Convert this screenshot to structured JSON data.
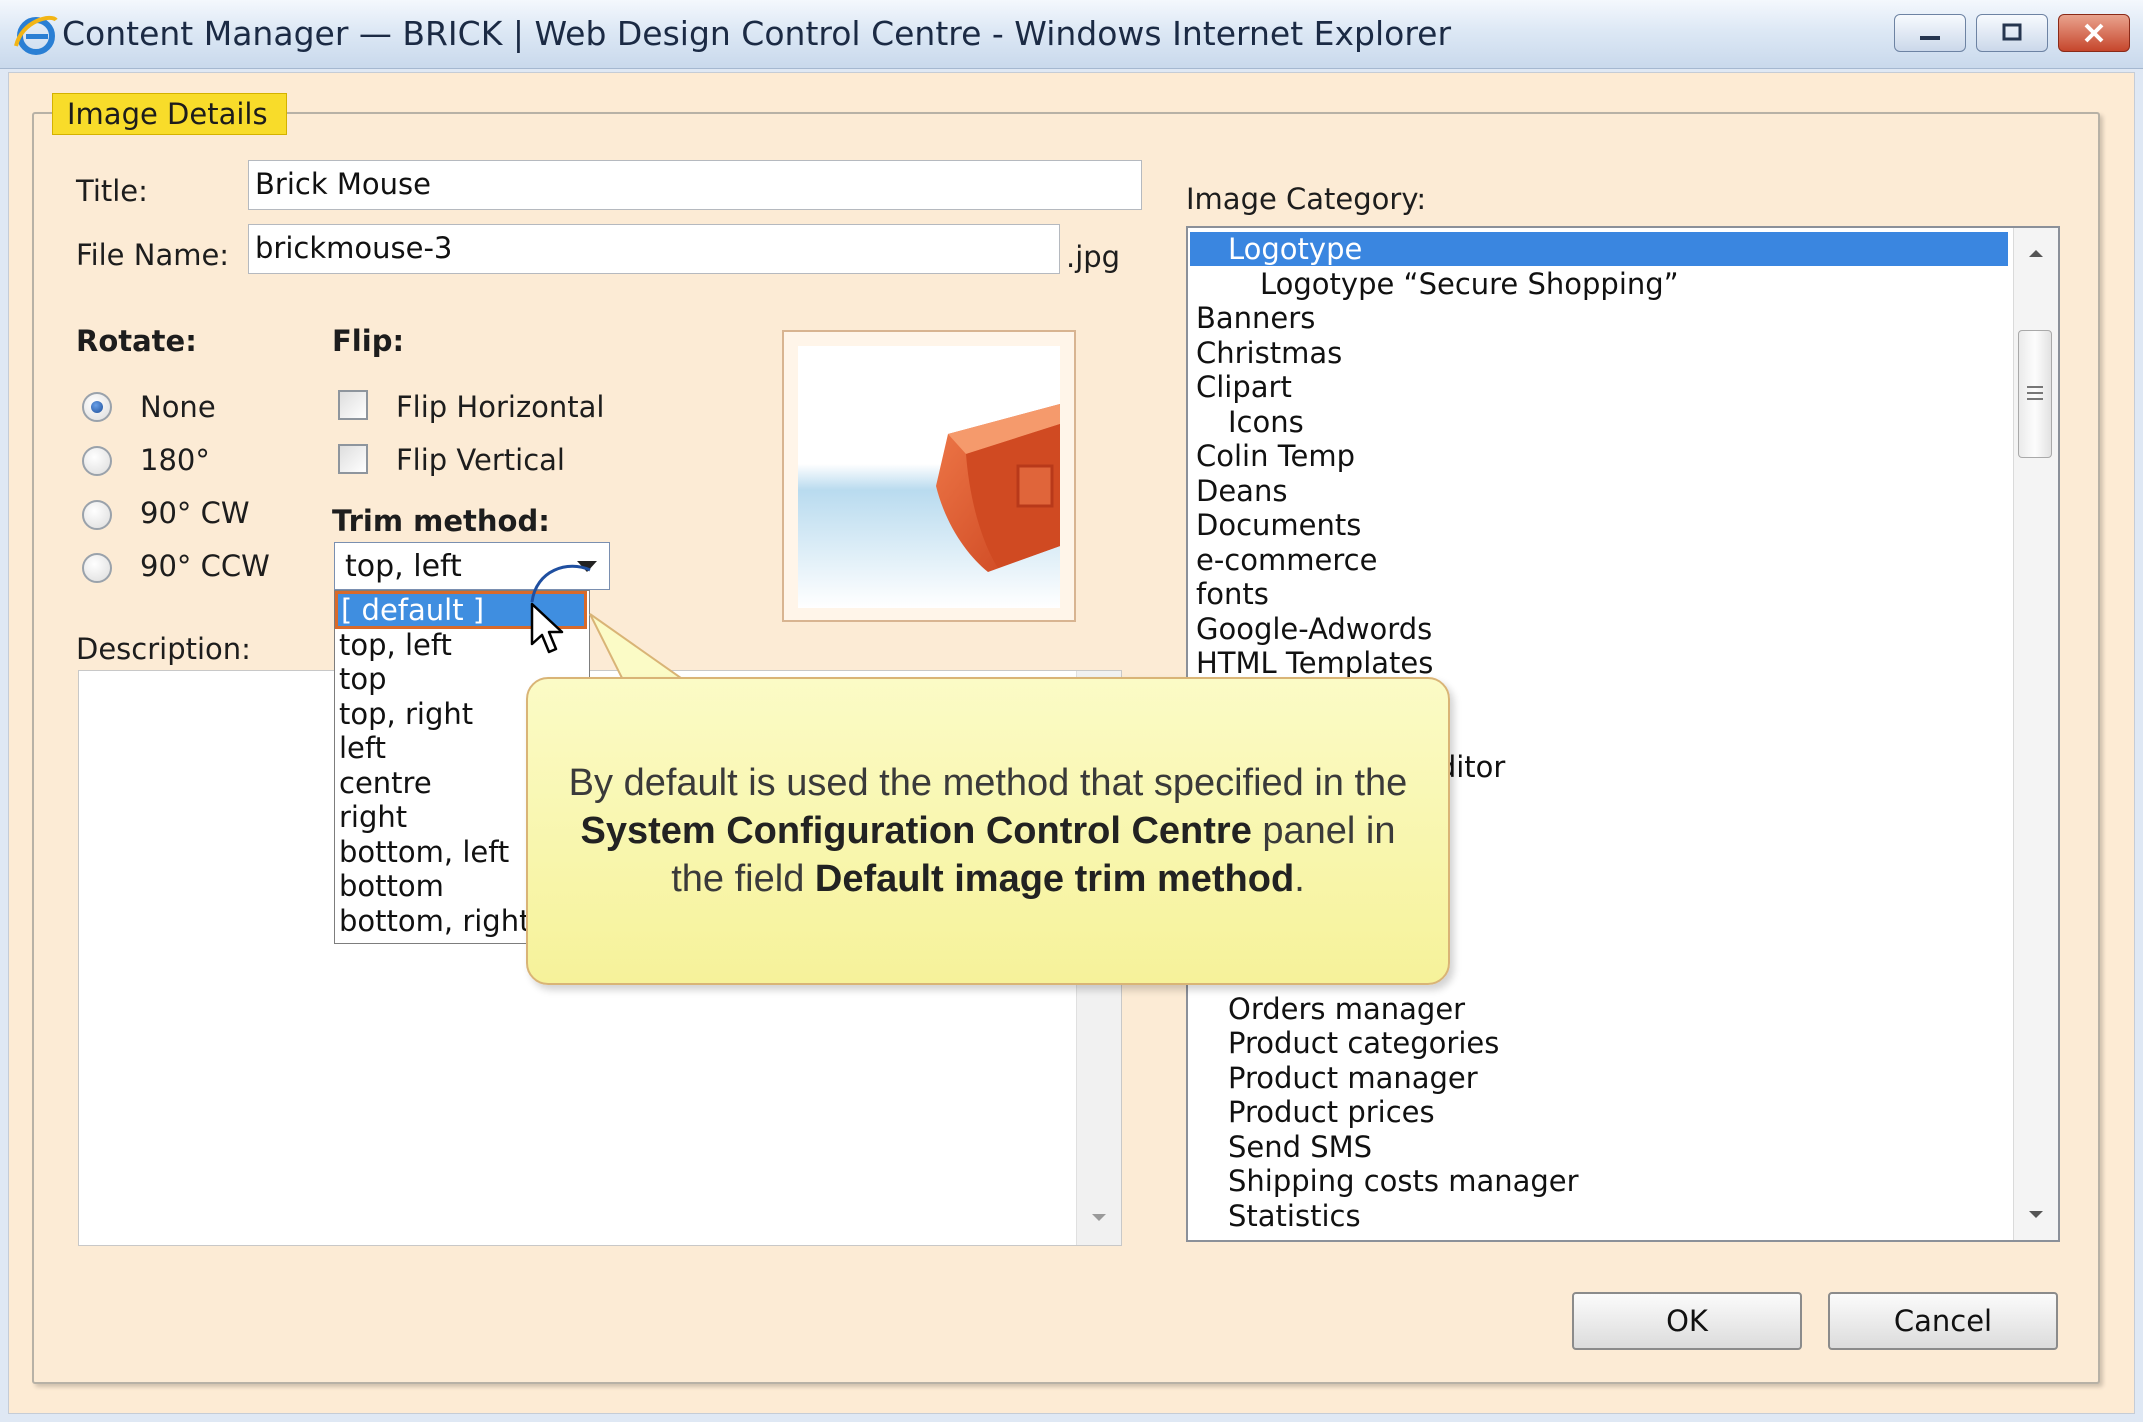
{
  "window": {
    "title": "Content Manager — BRICK | Web Design Control Centre - Windows Internet Explorer"
  },
  "dialog": {
    "legend": "Image Details",
    "title_label": "Title:",
    "title_value": "Brick Mouse",
    "filename_label": "File Name:",
    "filename_value": "brickmouse-3",
    "filename_ext": ".jpg",
    "rotate_label": "Rotate:",
    "rotate_options": [
      "None",
      "180°",
      "90° CW",
      "90° CCW"
    ],
    "rotate_selected": "None",
    "flip_label": "Flip:",
    "flip_options": [
      "Flip Horizontal",
      "Flip Vertical"
    ],
    "trim_label": "Trim method:",
    "trim_value": "top, left",
    "trim_options": [
      "[ default ]",
      "top, left",
      "top",
      "top, right",
      "left",
      "centre",
      "right",
      "bottom, left",
      "bottom",
      "bottom, right"
    ],
    "trim_highlighted": "[ default ]",
    "description_label": "Description:",
    "category_label": "Image Category:",
    "categories": [
      "Logotype",
      "Logotype “Secure Shopping”",
      "Banners",
      "Christmas",
      "Clipart",
      "Icons",
      "Colin Temp",
      "Deans",
      "Documents",
      "e-commerce",
      "fonts",
      "Google-Adwords",
      "HTML Templates",
      "editor",
      "Orders manager",
      "Product categories",
      "Product manager",
      "Product prices",
      "Send SMS",
      "Shipping costs manager",
      "Statistics"
    ],
    "category_selected": "Logotype",
    "ok_label": "OK",
    "cancel_label": "Cancel"
  },
  "callout": {
    "text_1": "By default is used the method that specified in the ",
    "bold_1": "System Configuration Control Centre",
    "text_2": " panel in the field ",
    "bold_2": "Default image trim method",
    "text_3": "."
  },
  "colors": {
    "legend_bg": "#f8dc2a",
    "dialog_bg": "#fcebd5",
    "selection": "#3a86e0",
    "callout_bg": "#f6f29a"
  }
}
